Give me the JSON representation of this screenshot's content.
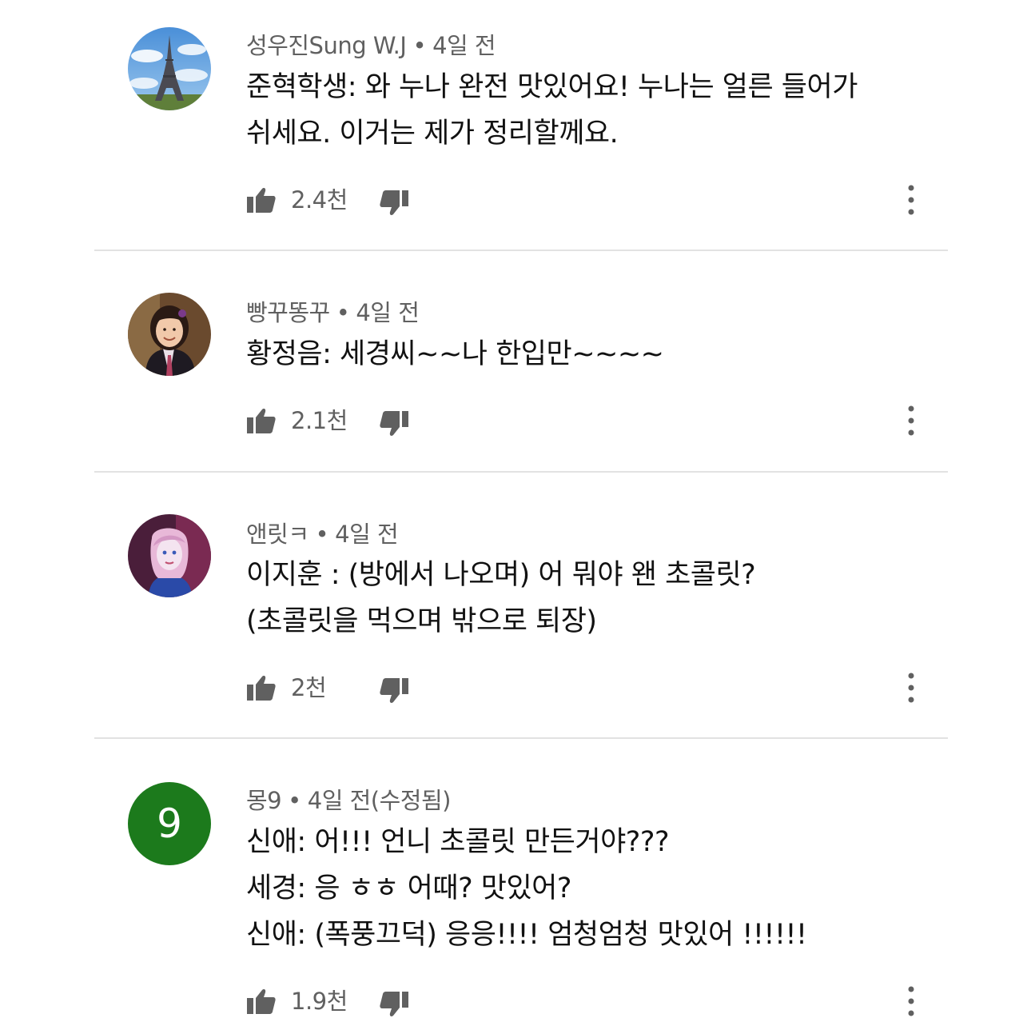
{
  "comments": [
    {
      "author": "성우진Sung W.J",
      "time": "4일 전",
      "lines": [
        "준혁학생: 와 누나 완전 맛있어요! 누나는 얼른 들어가",
        "쉬세요. 이거는 제가 정리할께요."
      ],
      "likes": "2.4천",
      "avatar_icon": "eiffel-tower-avatar"
    },
    {
      "author": "빵꾸똥꾸",
      "time": "4일 전",
      "lines": [
        "황정음: 세경씨~~나 한입만~~~~"
      ],
      "likes": "2.1천",
      "avatar_icon": "girl-photo-avatar"
    },
    {
      "author": "앤릿ㅋ",
      "time": "4일 전",
      "lines": [
        "이지훈 : (방에서 나오며) 어 뭐야 왠 초콜릿?",
        "(초콜릿을 먹으며 밖으로 퇴장)"
      ],
      "likes": "2천",
      "avatar_icon": "elsa-avatar"
    },
    {
      "author": "몽9",
      "time": "4일 전(수정됨)",
      "lines": [
        "신애: 어!!! 언니 초콜릿 만든거야???",
        "세경: 응 ㅎㅎ 어때? 맛있어?",
        "신애: (폭풍끄덕) 응응!!!! 엄청엄청 맛있어 !!!!!!"
      ],
      "likes": "1.9천",
      "avatar_icon": "letter-avatar",
      "avatar_letter": "9",
      "avatar_color": "#1c7a1c"
    }
  ],
  "separator": "•",
  "icons": {
    "like": "thumbs-up-icon",
    "dislike": "thumbs-down-icon",
    "more": "more-vert-icon"
  },
  "colors": {
    "meta_text": "#606060",
    "body_text": "#111111",
    "divider": "#e2e2e2"
  }
}
